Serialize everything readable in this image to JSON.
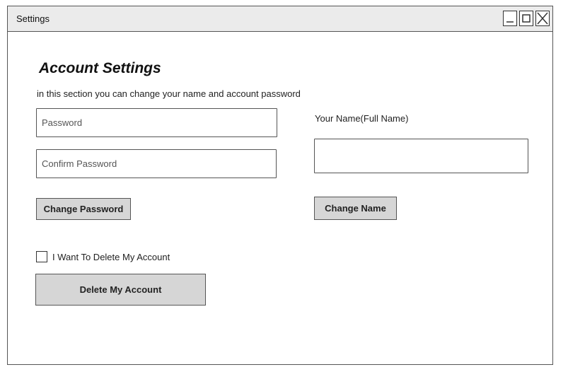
{
  "window": {
    "title": "Settings",
    "controls": {
      "minimize_icon": "minimize-icon",
      "maximize_icon": "maximize-icon",
      "close_icon": "close-icon"
    }
  },
  "account": {
    "heading": "Account Settings",
    "description": "in this section you can change your name and account  password"
  },
  "password": {
    "password_placeholder": "Password",
    "confirm_placeholder": "Confirm Password",
    "change_button_label": "Change Password"
  },
  "name": {
    "field_label": "Your Name(Full Name)",
    "value": "",
    "change_button_label": "Change Name"
  },
  "delete": {
    "checkbox_label": "I Want To Delete My Account",
    "checked": false,
    "button_label": "Delete My Account"
  },
  "colors": {
    "titlebar_background": "#ebebeb",
    "button_background": "#d6d6d6",
    "border": "#555555"
  }
}
